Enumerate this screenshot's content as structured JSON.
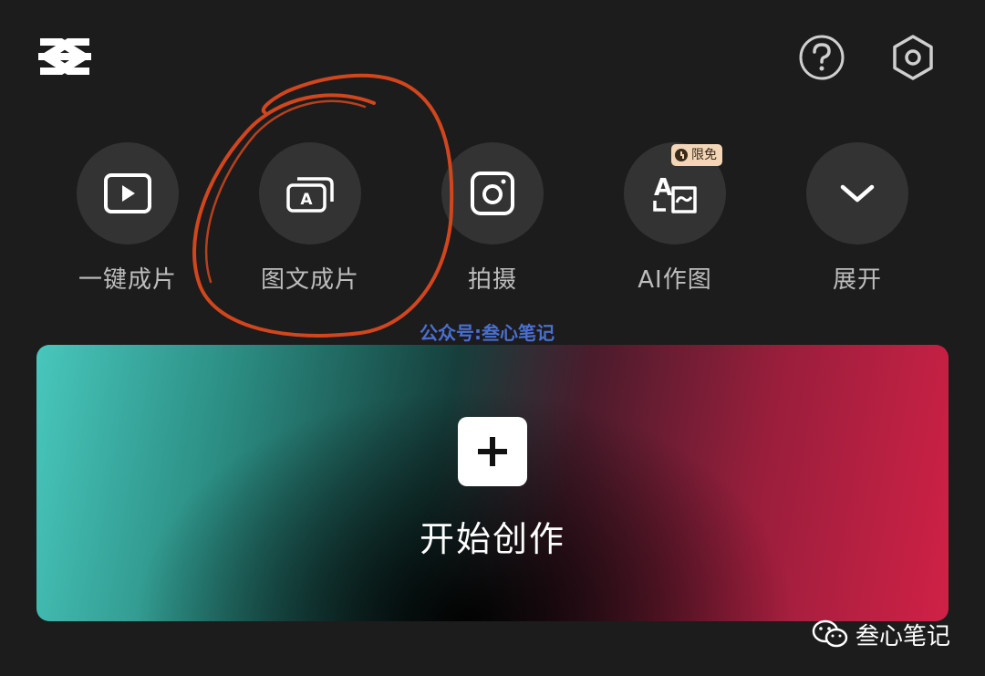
{
  "header": {
    "logo_icon": "capcut-logo-icon",
    "help_icon": "question-circle-icon",
    "settings_icon": "hexagon-settings-icon"
  },
  "tools": [
    {
      "id": "one-click",
      "icon": "play-square-icon",
      "label": "一键成片"
    },
    {
      "id": "image-text",
      "icon": "layered-image-text-icon",
      "label": "图文成片"
    },
    {
      "id": "shoot",
      "icon": "camera-icon",
      "label": "拍摄"
    },
    {
      "id": "ai-draw",
      "icon": "ai-translate-image-icon",
      "label": "AI作图",
      "badge": "限免"
    },
    {
      "id": "expand",
      "icon": "chevron-down-icon",
      "label": "展开"
    }
  ],
  "watermark_top": "公众号:叁心笔记",
  "create": {
    "label": "开始创作",
    "icon": "plus-icon"
  },
  "footer": {
    "text": "叁心笔记",
    "icon": "wechat-icon"
  },
  "colors": {
    "background": "#1c1c1c",
    "annotation": "#d2461e",
    "card_left": "#48c7bc",
    "card_right": "#d02146",
    "badge": "#f3d6b8",
    "watermark": "#4a6fd1"
  }
}
